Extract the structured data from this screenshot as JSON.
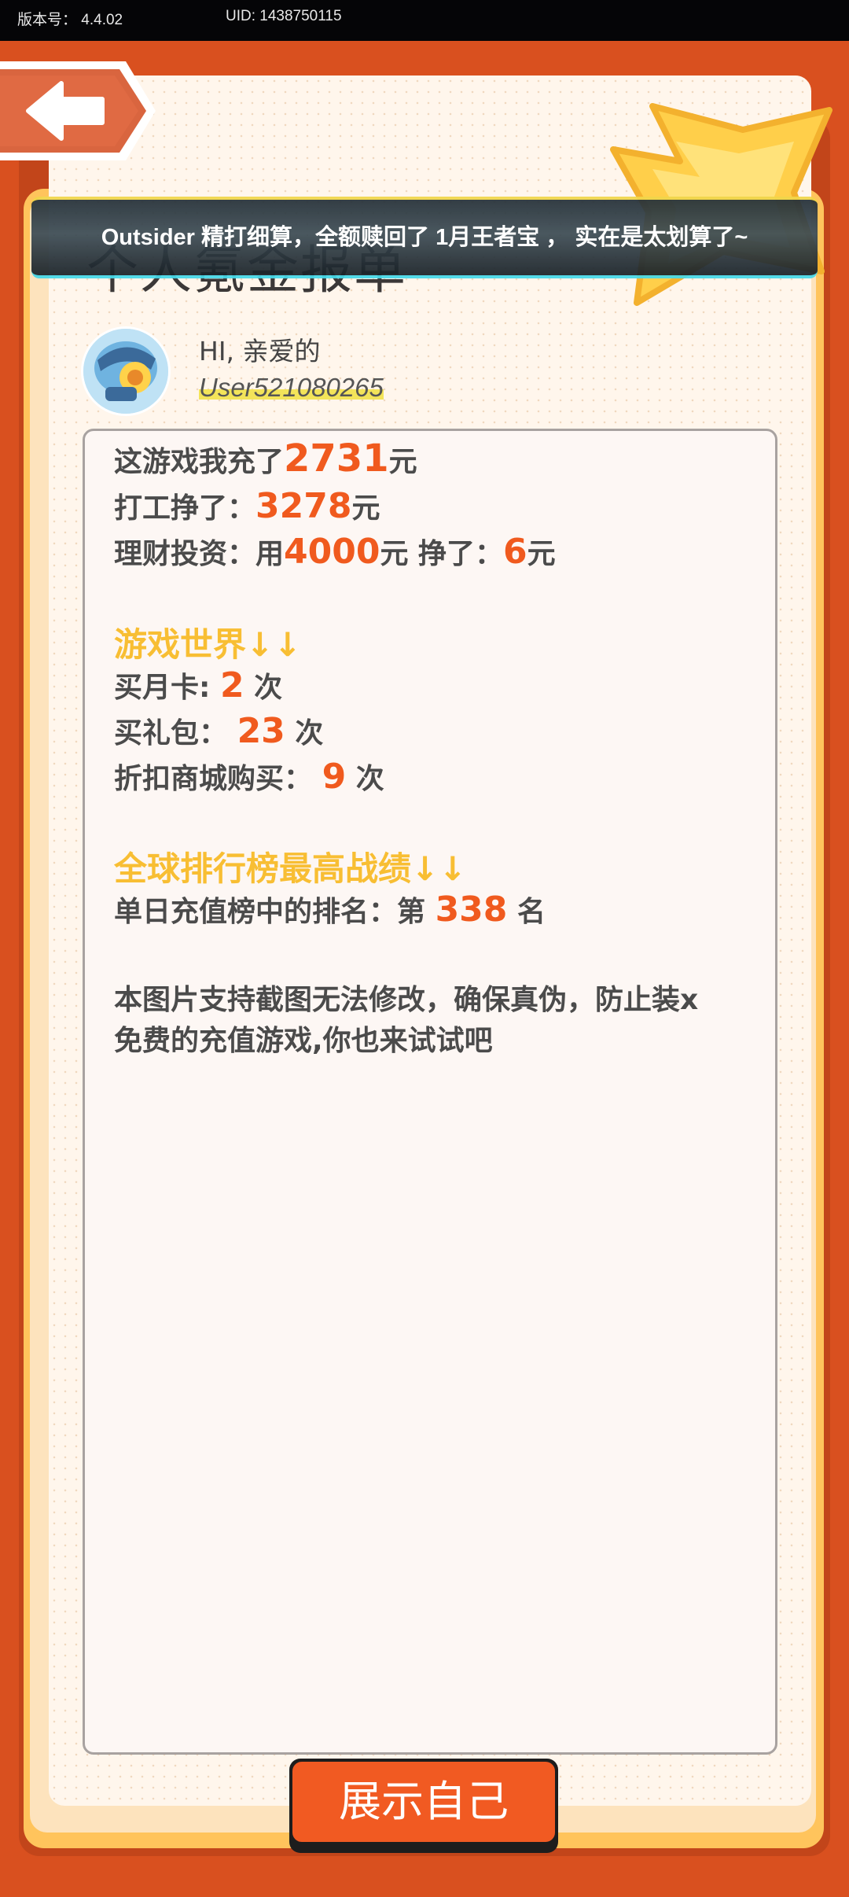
{
  "status_bar": {
    "version": "版本号： 4.4.02",
    "uid": "UID: 1438750115"
  },
  "header": {
    "title": "个人氪金报单",
    "banner": "Outsider 精打细算，全额赎回了 1月王者宝 ， 实在是太划算了~"
  },
  "profile": {
    "greeting": "HI, 亲爱的",
    "username": "User521080265"
  },
  "report": {
    "recharge_prefix": "这游戏我充了",
    "recharge_amount": "2731",
    "recharge_unit": "元",
    "work_prefix": "打工挣了：",
    "work_amount": "3278",
    "work_unit": "元",
    "invest_prefix": "理财投资：用",
    "invest_amount": "4000",
    "invest_mid": "元  挣了：",
    "invest_earned": "6",
    "invest_unit": "元",
    "game_section": "游戏世界↓↓",
    "monthly_card_prefix": "买月卡:",
    "monthly_card_count": "2",
    "gift_pack_prefix": "买礼包：",
    "gift_pack_count": "23",
    "discount_prefix": "折扣商城购买：",
    "discount_count": "9",
    "times_unit": "次",
    "rank_section": "全球排行榜最高战绩↓↓",
    "rank_prefix": "单日充值榜中的排名：第",
    "rank_value": "338",
    "rank_unit": "名",
    "footer_line1": "本图片支持截图无法修改，确保真伪，防止装x",
    "footer_line2": "免费的充值游戏,你也来试试吧"
  },
  "buttons": {
    "show_self": "展示自己"
  },
  "colors": {
    "frame": "#d9501f",
    "accent_number": "#f05a1e",
    "section_heading": "#f8be33",
    "button": "#f15a22"
  },
  "icons": {
    "back": "back-arrow-icon",
    "badge": "star-badge-icon",
    "avatar": "robot-avatar-icon"
  }
}
